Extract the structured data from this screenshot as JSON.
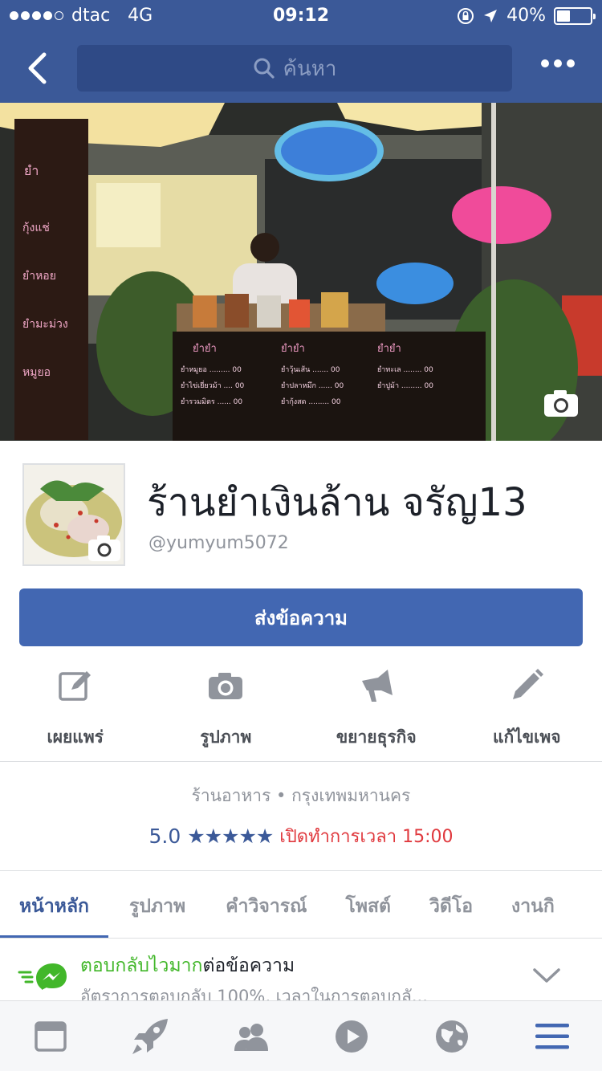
{
  "status_bar": {
    "carrier": "dtac",
    "network": "4G",
    "time": "09:12",
    "battery": "40%"
  },
  "nav": {
    "search_placeholder": "ค้นหา"
  },
  "page": {
    "name": "ร้านยำเงินล้าน จรัญ13",
    "handle": "@yumyum5072",
    "send_message_label": "ส่งข้อความ"
  },
  "actions": [
    {
      "label": "เผยแพร่",
      "icon": "compose-icon"
    },
    {
      "label": "รูปภาพ",
      "icon": "camera-icon"
    },
    {
      "label": "ขยายธุรกิจ",
      "icon": "megaphone-icon"
    },
    {
      "label": "แก้ไขเพจ",
      "icon": "pencil-icon"
    }
  ],
  "info": {
    "category_line": "ร้านอาหาร • กรุงเทพมหานคร",
    "rating": "5.0",
    "stars": "★★★★★",
    "rating_value": 5,
    "open_text": "เปิดทำการเวลา 15:00"
  },
  "tabs": [
    {
      "label": "หน้าหลัก",
      "active": true
    },
    {
      "label": "รูปภาพ"
    },
    {
      "label": "คำวิจารณ์"
    },
    {
      "label": "โพสต์"
    },
    {
      "label": "วิดีโอ"
    },
    {
      "label": "งานกิ"
    }
  ],
  "responsiveness": {
    "highlight": "ตอบกลับไวมาก",
    "rest": "ต่อข้อความ",
    "detail": "อัตราการตอบกลับ 100%, เวลาในการตอบกลั..."
  },
  "bottom_tabs": [
    "news-feed-icon",
    "rocket-icon",
    "friends-icon",
    "video-icon",
    "globe-icon",
    "menu-icon"
  ],
  "colors": {
    "brand": "#3b5998",
    "button": "#4267b2",
    "open_red": "#e0393e",
    "messenger_green": "#42b72a"
  }
}
